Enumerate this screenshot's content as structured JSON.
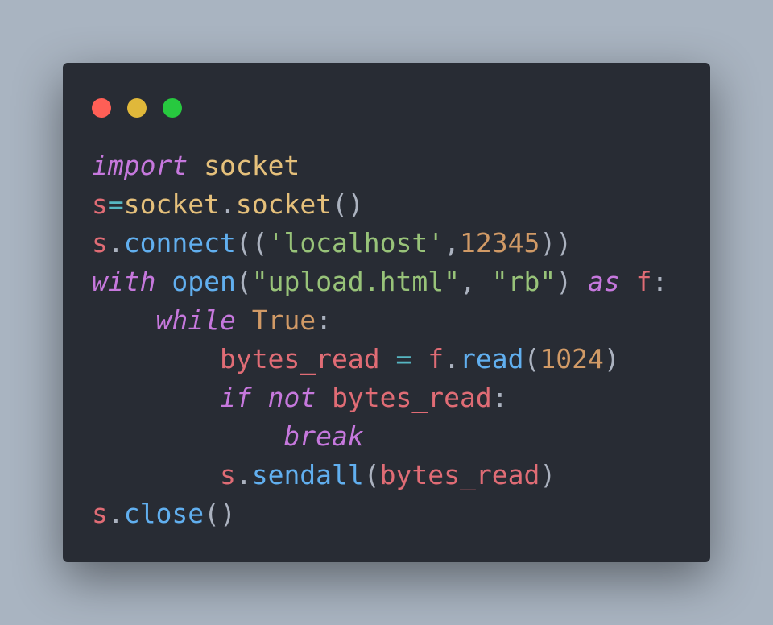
{
  "window": {
    "controls": [
      {
        "name": "close",
        "color": "#ff5f56"
      },
      {
        "name": "minimize",
        "color": "#e0b83a"
      },
      {
        "name": "maximize",
        "color": "#27c93f"
      }
    ]
  },
  "code": {
    "lines": [
      [
        {
          "t": "import",
          "c": "kw"
        },
        {
          "t": " ",
          "c": "punc"
        },
        {
          "t": "socket",
          "c": "mod"
        }
      ],
      [
        {
          "t": "s",
          "c": "var"
        },
        {
          "t": "=",
          "c": "op"
        },
        {
          "t": "socket",
          "c": "mod"
        },
        {
          "t": ".",
          "c": "punc"
        },
        {
          "t": "socket",
          "c": "mod"
        },
        {
          "t": "()",
          "c": "punc"
        }
      ],
      [
        {
          "t": "s",
          "c": "var"
        },
        {
          "t": ".",
          "c": "punc"
        },
        {
          "t": "connect",
          "c": "fn"
        },
        {
          "t": "((",
          "c": "punc"
        },
        {
          "t": "'localhost'",
          "c": "str"
        },
        {
          "t": ",",
          "c": "punc"
        },
        {
          "t": "12345",
          "c": "num"
        },
        {
          "t": "))",
          "c": "punc"
        }
      ],
      [
        {
          "t": "with",
          "c": "kw"
        },
        {
          "t": " ",
          "c": "punc"
        },
        {
          "t": "open",
          "c": "fn"
        },
        {
          "t": "(",
          "c": "punc"
        },
        {
          "t": "\"upload.html\"",
          "c": "str"
        },
        {
          "t": ", ",
          "c": "punc"
        },
        {
          "t": "\"rb\"",
          "c": "str"
        },
        {
          "t": ") ",
          "c": "punc"
        },
        {
          "t": "as",
          "c": "kw"
        },
        {
          "t": " ",
          "c": "punc"
        },
        {
          "t": "f",
          "c": "var"
        },
        {
          "t": ":",
          "c": "punc"
        }
      ],
      [
        {
          "t": "    ",
          "c": "punc"
        },
        {
          "t": "while",
          "c": "kw"
        },
        {
          "t": " ",
          "c": "punc"
        },
        {
          "t": "True",
          "c": "const"
        },
        {
          "t": ":",
          "c": "punc"
        }
      ],
      [
        {
          "t": "        ",
          "c": "punc"
        },
        {
          "t": "bytes_read",
          "c": "var"
        },
        {
          "t": " ",
          "c": "punc"
        },
        {
          "t": "=",
          "c": "op"
        },
        {
          "t": " ",
          "c": "punc"
        },
        {
          "t": "f",
          "c": "var"
        },
        {
          "t": ".",
          "c": "punc"
        },
        {
          "t": "read",
          "c": "fn"
        },
        {
          "t": "(",
          "c": "punc"
        },
        {
          "t": "1024",
          "c": "num"
        },
        {
          "t": ")",
          "c": "punc"
        }
      ],
      [
        {
          "t": "        ",
          "c": "punc"
        },
        {
          "t": "if",
          "c": "kw"
        },
        {
          "t": " ",
          "c": "punc"
        },
        {
          "t": "not",
          "c": "kw"
        },
        {
          "t": " ",
          "c": "punc"
        },
        {
          "t": "bytes_read",
          "c": "var"
        },
        {
          "t": ":",
          "c": "punc"
        }
      ],
      [
        {
          "t": "            ",
          "c": "punc"
        },
        {
          "t": "break",
          "c": "kw"
        }
      ],
      [
        {
          "t": "        ",
          "c": "punc"
        },
        {
          "t": "s",
          "c": "var"
        },
        {
          "t": ".",
          "c": "punc"
        },
        {
          "t": "sendall",
          "c": "fn"
        },
        {
          "t": "(",
          "c": "punc"
        },
        {
          "t": "bytes_read",
          "c": "var"
        },
        {
          "t": ")",
          "c": "punc"
        }
      ],
      [
        {
          "t": "s",
          "c": "var"
        },
        {
          "t": ".",
          "c": "punc"
        },
        {
          "t": "close",
          "c": "fn"
        },
        {
          "t": "()",
          "c": "punc"
        }
      ]
    ]
  }
}
